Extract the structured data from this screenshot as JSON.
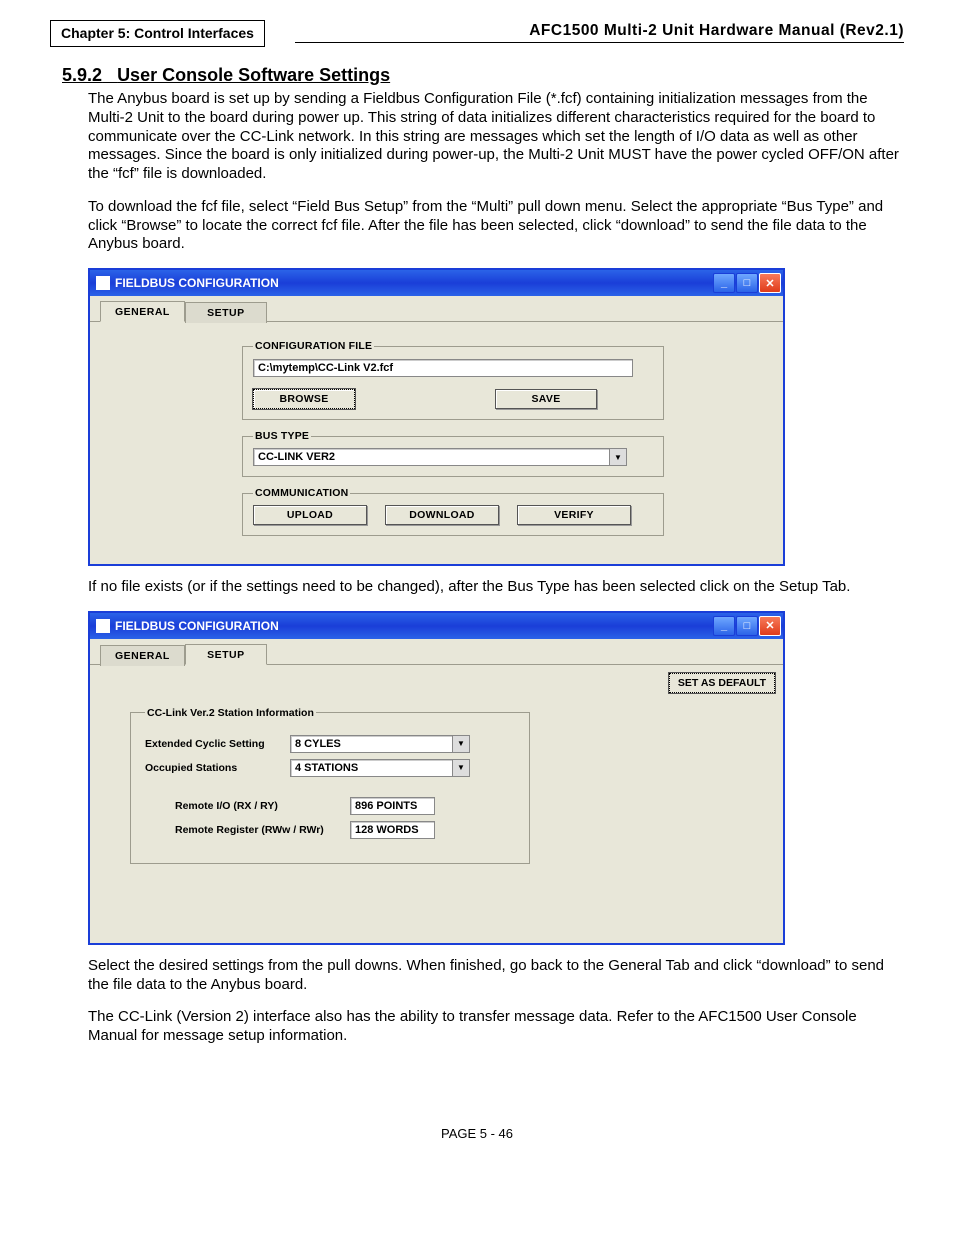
{
  "header": {
    "chapter": "Chapter 5: Control Interfaces",
    "manual": "AFC1500 Multi-2 Unit Hardware Manual (Rev2.1)"
  },
  "section": {
    "number": "5.9.2",
    "title": "User Console Software Settings"
  },
  "paragraphs": {
    "p1": "The Anybus board is set up by sending a Fieldbus Configuration File (*.fcf) containing initialization messages from the Multi-2 Unit to the board during power up. This string of data initializes different characteristics required for the board to communicate over the CC-Link network. In this string are messages which set the length of I/O data as well as other messages. Since the board is only initialized during power-up, the Multi-2 Unit MUST have the power cycled OFF/ON after the “fcf” file is downloaded.",
    "p2": "To download the fcf file, select “Field Bus Setup” from the “Multi” pull down menu. Select the appropriate “Bus Type” and click “Browse” to locate the correct fcf file. After the file has been selected, click “download” to send the file data to the Anybus board.",
    "p3": "If no file exists (or if the settings need to be changed), after the Bus Type has been selected click on the Setup Tab.",
    "p4": "Select the desired settings from the pull downs. When finished, go back to the General Tab and click “download” to send the file data to the Anybus board.",
    "p5": "The CC-Link (Version 2) interface also has the ability to transfer message data. Refer to the AFC1500 User Console Manual for message setup information."
  },
  "win1": {
    "title": "FIELDBUS CONFIGURATION",
    "tabs": {
      "general": "GENERAL",
      "setup": "SETUP"
    },
    "groups": {
      "configfile": {
        "legend": "CONFIGURATION FILE",
        "value": "C:\\mytemp\\CC-Link V2.fcf",
        "browse": "BROWSE",
        "save": "SAVE"
      },
      "bustype": {
        "legend": "BUS TYPE",
        "value": "CC-LINK VER2"
      },
      "comm": {
        "legend": "COMMUNICATION",
        "upload": "UPLOAD",
        "download": "DOWNLOAD",
        "verify": "VERIFY"
      }
    }
  },
  "win2": {
    "title": "FIELDBUS CONFIGURATION",
    "tabs": {
      "general": "GENERAL",
      "setup": "SETUP"
    },
    "setdefault": "SET AS DEFAULT",
    "station": {
      "legend": "CC-Link Ver.2 Station Information",
      "extcyclic_label": "Extended Cyclic Setting",
      "extcyclic_value": "8 CYLES",
      "occ_label": "Occupied Stations",
      "occ_value": "4 STATIONS",
      "rio_label": "Remote I/O (RX / RY)",
      "rio_value": "896 POINTS",
      "rreg_label": "Remote Register (RWw / RWr)",
      "rreg_value": "128 WORDS"
    }
  },
  "footer": "PAGE 5 - 46"
}
